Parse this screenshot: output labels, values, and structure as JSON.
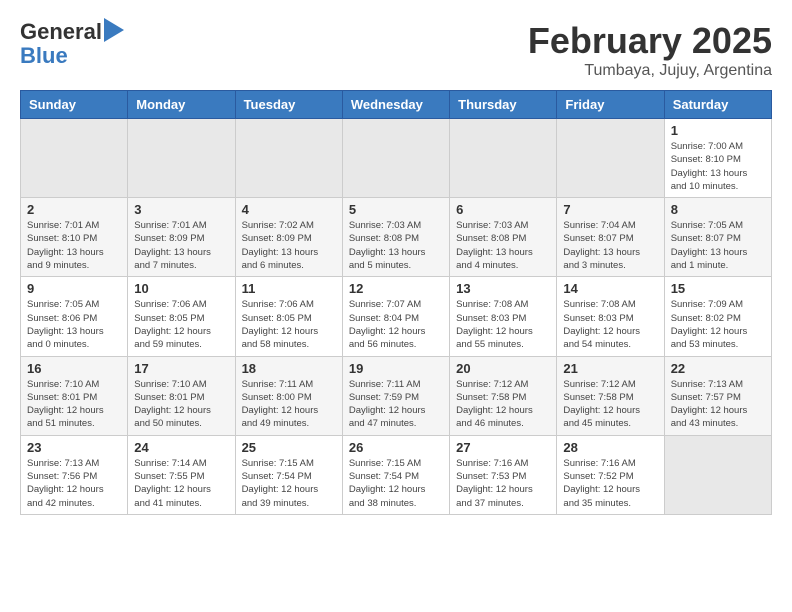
{
  "header": {
    "logo_line1": "General",
    "logo_line2": "Blue",
    "title": "February 2025",
    "subtitle": "Tumbaya, Jujuy, Argentina"
  },
  "weekdays": [
    "Sunday",
    "Monday",
    "Tuesday",
    "Wednesday",
    "Thursday",
    "Friday",
    "Saturday"
  ],
  "weeks": [
    [
      {
        "day": "",
        "info": ""
      },
      {
        "day": "",
        "info": ""
      },
      {
        "day": "",
        "info": ""
      },
      {
        "day": "",
        "info": ""
      },
      {
        "day": "",
        "info": ""
      },
      {
        "day": "",
        "info": ""
      },
      {
        "day": "1",
        "info": "Sunrise: 7:00 AM\nSunset: 8:10 PM\nDaylight: 13 hours\nand 10 minutes."
      }
    ],
    [
      {
        "day": "2",
        "info": "Sunrise: 7:01 AM\nSunset: 8:10 PM\nDaylight: 13 hours\nand 9 minutes."
      },
      {
        "day": "3",
        "info": "Sunrise: 7:01 AM\nSunset: 8:09 PM\nDaylight: 13 hours\nand 7 minutes."
      },
      {
        "day": "4",
        "info": "Sunrise: 7:02 AM\nSunset: 8:09 PM\nDaylight: 13 hours\nand 6 minutes."
      },
      {
        "day": "5",
        "info": "Sunrise: 7:03 AM\nSunset: 8:08 PM\nDaylight: 13 hours\nand 5 minutes."
      },
      {
        "day": "6",
        "info": "Sunrise: 7:03 AM\nSunset: 8:08 PM\nDaylight: 13 hours\nand 4 minutes."
      },
      {
        "day": "7",
        "info": "Sunrise: 7:04 AM\nSunset: 8:07 PM\nDaylight: 13 hours\nand 3 minutes."
      },
      {
        "day": "8",
        "info": "Sunrise: 7:05 AM\nSunset: 8:07 PM\nDaylight: 13 hours\nand 1 minute."
      }
    ],
    [
      {
        "day": "9",
        "info": "Sunrise: 7:05 AM\nSunset: 8:06 PM\nDaylight: 13 hours\nand 0 minutes."
      },
      {
        "day": "10",
        "info": "Sunrise: 7:06 AM\nSunset: 8:05 PM\nDaylight: 12 hours\nand 59 minutes."
      },
      {
        "day": "11",
        "info": "Sunrise: 7:06 AM\nSunset: 8:05 PM\nDaylight: 12 hours\nand 58 minutes."
      },
      {
        "day": "12",
        "info": "Sunrise: 7:07 AM\nSunset: 8:04 PM\nDaylight: 12 hours\nand 56 minutes."
      },
      {
        "day": "13",
        "info": "Sunrise: 7:08 AM\nSunset: 8:03 PM\nDaylight: 12 hours\nand 55 minutes."
      },
      {
        "day": "14",
        "info": "Sunrise: 7:08 AM\nSunset: 8:03 PM\nDaylight: 12 hours\nand 54 minutes."
      },
      {
        "day": "15",
        "info": "Sunrise: 7:09 AM\nSunset: 8:02 PM\nDaylight: 12 hours\nand 53 minutes."
      }
    ],
    [
      {
        "day": "16",
        "info": "Sunrise: 7:10 AM\nSunset: 8:01 PM\nDaylight: 12 hours\nand 51 minutes."
      },
      {
        "day": "17",
        "info": "Sunrise: 7:10 AM\nSunset: 8:01 PM\nDaylight: 12 hours\nand 50 minutes."
      },
      {
        "day": "18",
        "info": "Sunrise: 7:11 AM\nSunset: 8:00 PM\nDaylight: 12 hours\nand 49 minutes."
      },
      {
        "day": "19",
        "info": "Sunrise: 7:11 AM\nSunset: 7:59 PM\nDaylight: 12 hours\nand 47 minutes."
      },
      {
        "day": "20",
        "info": "Sunrise: 7:12 AM\nSunset: 7:58 PM\nDaylight: 12 hours\nand 46 minutes."
      },
      {
        "day": "21",
        "info": "Sunrise: 7:12 AM\nSunset: 7:58 PM\nDaylight: 12 hours\nand 45 minutes."
      },
      {
        "day": "22",
        "info": "Sunrise: 7:13 AM\nSunset: 7:57 PM\nDaylight: 12 hours\nand 43 minutes."
      }
    ],
    [
      {
        "day": "23",
        "info": "Sunrise: 7:13 AM\nSunset: 7:56 PM\nDaylight: 12 hours\nand 42 minutes."
      },
      {
        "day": "24",
        "info": "Sunrise: 7:14 AM\nSunset: 7:55 PM\nDaylight: 12 hours\nand 41 minutes."
      },
      {
        "day": "25",
        "info": "Sunrise: 7:15 AM\nSunset: 7:54 PM\nDaylight: 12 hours\nand 39 minutes."
      },
      {
        "day": "26",
        "info": "Sunrise: 7:15 AM\nSunset: 7:54 PM\nDaylight: 12 hours\nand 38 minutes."
      },
      {
        "day": "27",
        "info": "Sunrise: 7:16 AM\nSunset: 7:53 PM\nDaylight: 12 hours\nand 37 minutes."
      },
      {
        "day": "28",
        "info": "Sunrise: 7:16 AM\nSunset: 7:52 PM\nDaylight: 12 hours\nand 35 minutes."
      },
      {
        "day": "",
        "info": ""
      }
    ]
  ]
}
